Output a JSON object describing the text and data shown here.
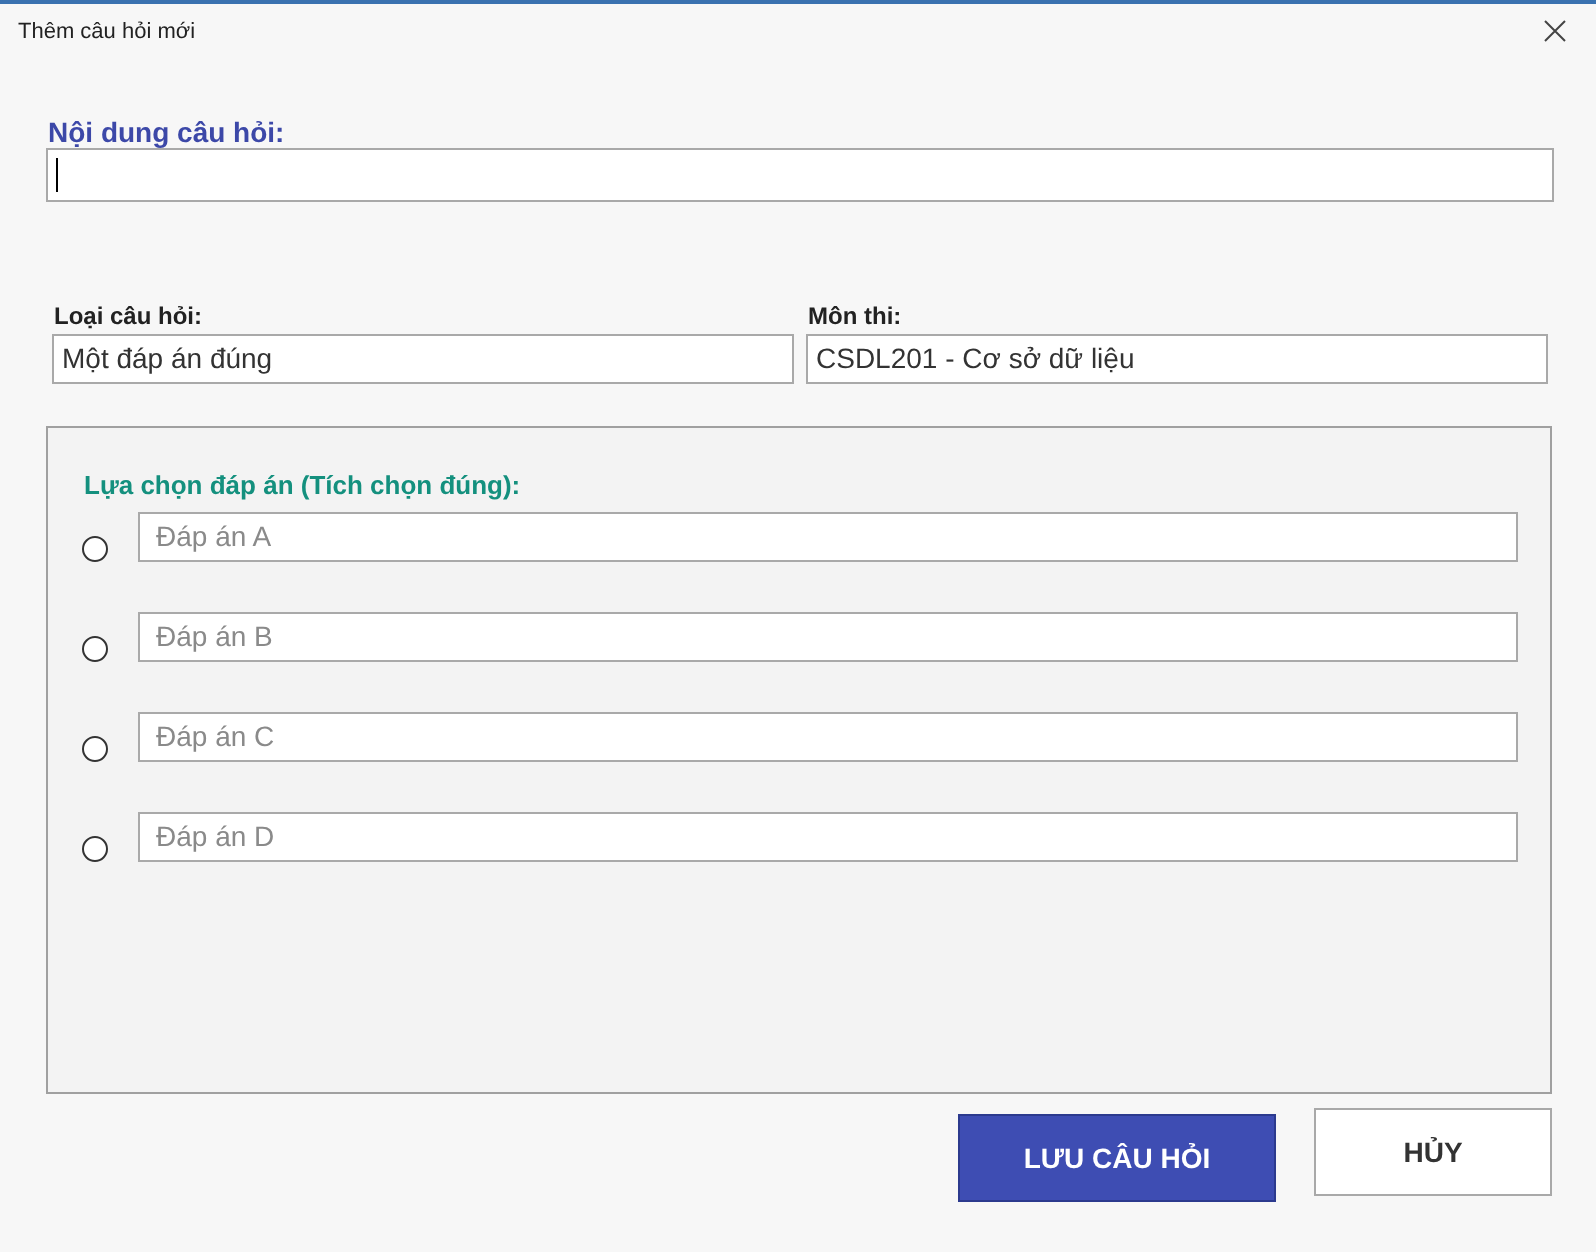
{
  "window": {
    "title": "Thêm câu hỏi mới"
  },
  "question": {
    "label": "Nội dung câu hỏi:",
    "focused": true
  },
  "fields": [
    {
      "label": "Loại câu hỏi:",
      "value": "Một đáp án đúng"
    },
    {
      "label": "Môn thi:",
      "value": "CSDL201 - Cơ sở dữ liệu"
    }
  ],
  "answers_group": {
    "title": "Lựa chọn đáp án (Tích chọn đúng):",
    "options": [
      {
        "placeholder": "Đáp án A",
        "selected": false
      },
      {
        "placeholder": "Đáp án B",
        "selected": false
      },
      {
        "placeholder": "Đáp án C",
        "selected": false
      },
      {
        "placeholder": "Đáp án D",
        "selected": false
      }
    ]
  },
  "buttons": [
    {
      "label": "LƯU CÂU HỎI",
      "kind": "primary"
    },
    {
      "label": "HỦY",
      "kind": "secondary"
    }
  ]
}
